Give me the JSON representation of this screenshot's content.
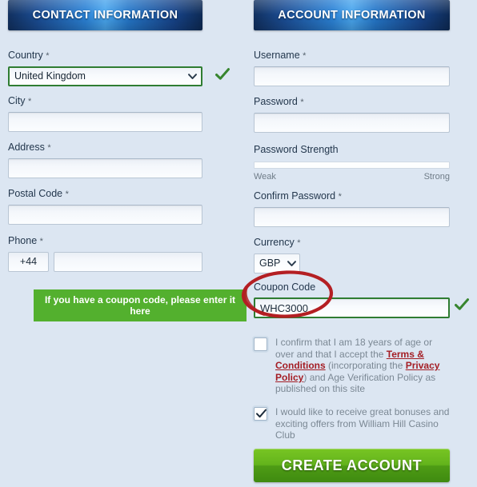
{
  "colors": {
    "page_background": "#dce6f2",
    "header_blue": "#2b82d6",
    "valid_green": "#2f7d32",
    "banner_green": "#53b02e",
    "cta_green": "#63b41c",
    "annotation_red": "#b41f23",
    "link_red": "#a41d24"
  },
  "contact": {
    "header": "CONTACT INFORMATION",
    "country": {
      "label": "Country",
      "required": "*",
      "value": "United Kingdom",
      "valid": "check-icon",
      "chevron": "chevron-down-icon"
    },
    "city": {
      "label": "City",
      "required": "*",
      "value": "",
      "placeholder": ""
    },
    "address": {
      "label": "Address",
      "required": "*",
      "value": "",
      "placeholder": ""
    },
    "postal_code": {
      "label": "Postal Code",
      "required": "*",
      "value": "",
      "placeholder": ""
    },
    "phone": {
      "label": "Phone",
      "required": "*",
      "country_code": "+44",
      "number": "",
      "placeholder": ""
    }
  },
  "account": {
    "header": "ACCOUNT INFORMATION",
    "username": {
      "label": "Username",
      "required": "*",
      "value": "",
      "placeholder": ""
    },
    "password": {
      "label": "Password",
      "required": "*",
      "value": "",
      "placeholder": ""
    },
    "password_strength": {
      "label": "Password Strength",
      "weak_label": "Weak",
      "strong_label": "Strong",
      "percent": 0
    },
    "confirm_password": {
      "label": "Confirm Password",
      "required": "*",
      "value": "",
      "placeholder": ""
    },
    "currency": {
      "label": "Currency",
      "required": "*",
      "value": "GBP",
      "chevron": "chevron-down-icon"
    },
    "coupon": {
      "label": "Coupon Code",
      "value": "WHC3000",
      "placeholder": "",
      "valid": "check-icon"
    }
  },
  "coupon_banner": {
    "text": "If you have a coupon code, please enter it here"
  },
  "annotation": {
    "shape": "red-ellipse-highlight",
    "target": "coupon-code-field"
  },
  "terms": {
    "checked": false,
    "text_before": "I confirm that I am 18 years of age or over and that I accept the ",
    "link1": "Terms & Conditions",
    "text_mid": " (incorporating the ",
    "link2": "Privacy Policy",
    "text_after": ") and Age Verification Policy as published on this site"
  },
  "marketing": {
    "checked": true,
    "check_icon": "check-icon",
    "text": "I would like to receive great bonuses and exciting offers from William Hill Casino Club"
  },
  "submit": {
    "label": "CREATE ACCOUNT"
  }
}
